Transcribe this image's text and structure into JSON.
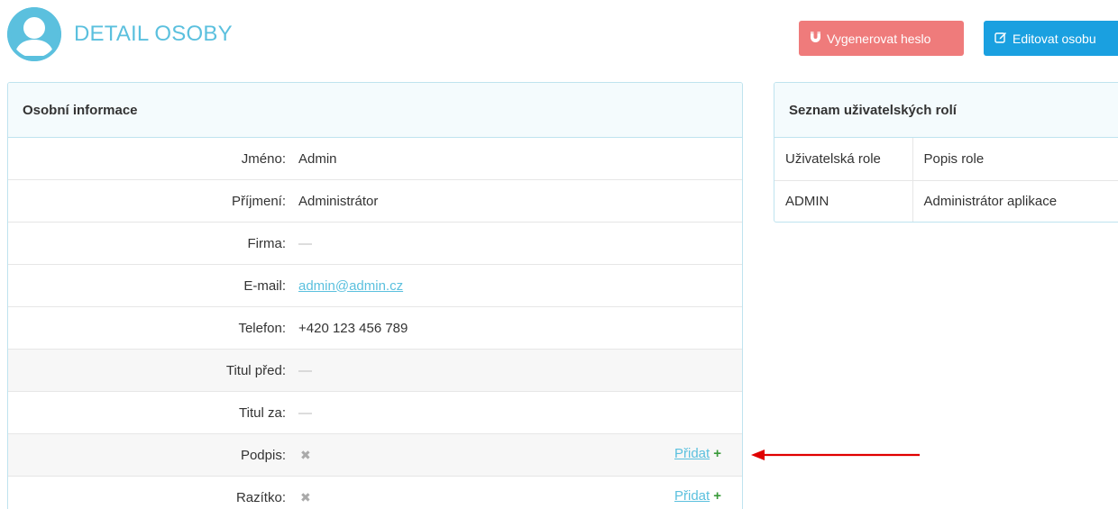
{
  "header": {
    "title": "DETAIL OSOBY"
  },
  "actions": {
    "generate_password": "Vygenerovat heslo",
    "edit_person": "Editovat osobu"
  },
  "personal_info": {
    "heading": "Osobní informace",
    "rows": [
      {
        "label": "Jméno:",
        "value": "Admin"
      },
      {
        "label": "Příjmení:",
        "value": "Administrátor"
      },
      {
        "label": "Firma:",
        "value": "—"
      },
      {
        "label": "E-mail:",
        "value": "admin@admin.cz"
      },
      {
        "label": "Telefon:",
        "value": "+420 123 456 789"
      },
      {
        "label": "Titul před:",
        "value": "—"
      },
      {
        "label": "Titul za:",
        "value": "—"
      },
      {
        "label": "Podpis:",
        "value": "✖",
        "action": "Přidat"
      },
      {
        "label": "Razítko:",
        "value": "✖",
        "action": "Přidat"
      }
    ]
  },
  "roles": {
    "heading": "Seznam uživatelských rolí",
    "columns": [
      "Uživatelská role",
      "Popis role"
    ],
    "rows": [
      [
        "ADMIN",
        "Administrátor aplikace"
      ]
    ]
  },
  "icons": {
    "avatar": "user-avatar-icon",
    "generate": "magnet-icon",
    "edit": "edit-icon",
    "add": "plus-icon",
    "missing": "x-mark-icon",
    "annotation": "red-arrow-icon"
  },
  "colors": {
    "accent": "#5bc0de",
    "danger_button": "#ef7b7b",
    "primary_button": "#1aa0e0",
    "add_plus": "#3a9a3a",
    "annotation_arrow": "#e00000"
  }
}
